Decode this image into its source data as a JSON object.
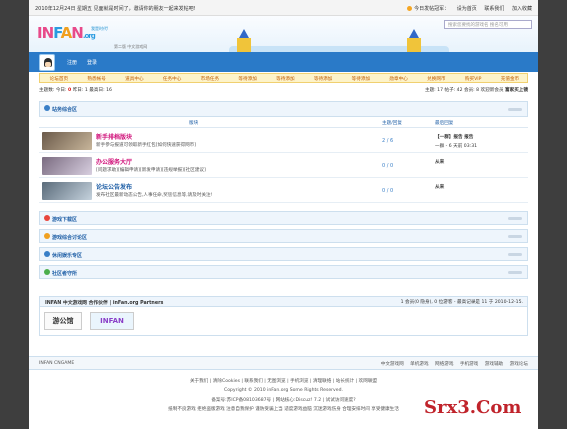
{
  "topbar": {
    "left_text": "2010年12月24日 星期五 见面就是时间了，邀请你的朋友一起来发帖吧!",
    "right_links": [
      "今日发帖冠军：",
      "设为首页",
      "联系我们",
      "加入收藏"
    ]
  },
  "header": {
    "logo_parts": [
      "IN",
      "F",
      "A",
      "N",
      ".org"
    ],
    "logo_slogan": "我是时代!",
    "site_subtitle": "第二版 中文游戏网",
    "search_placeholder": "搜索您要找的游戏名  搜名可用"
  },
  "nav": {
    "register": "注册",
    "login": "登录"
  },
  "menu": [
    "论坛首页",
    "熟悉帐号",
    "道具中心",
    "任务中心",
    "市场任务",
    "等待添加",
    "等待添加",
    "等待添加",
    "等待添加",
    "勋章中心",
    "兑换网币",
    "购买VIP",
    "充值金币"
  ],
  "stats": {
    "left": "主题数:",
    "today_label": "今日:",
    "today_value": "0",
    "rest": "昨日: 1  最高日: 16",
    "right": "主题: 17  帖子: 42  会员: 8  欢迎新会员",
    "newest_member": "富家买上镜"
  },
  "section_main": {
    "title": "站务综合区",
    "col_forum": "版块",
    "col_posts": "主题/回复",
    "col_last": "最后回复"
  },
  "forums": [
    {
      "name": "新手排档版块",
      "desc": "新手参与报道可领取新手红包[如何快速获得网币]",
      "name_color": "#d0127a",
      "count": "2 / 6",
      "last_title": "【一群】报告  报告",
      "last_info": "一群 - 6 天前 03:31",
      "thumb_colors": [
        "#6b5a4a",
        "#c7b59a"
      ]
    },
    {
      "name": "办公服务大厅",
      "desc": "[问题求助][编辑申请][新发申请][违规举报][社区建议]",
      "name_color": "#d0127a",
      "count": "0 / 0",
      "last_title": "从来",
      "last_info": "",
      "thumb_colors": [
        "#7a6b80",
        "#d8cfe0"
      ]
    },
    {
      "name": "论坛公告发布",
      "desc": "发布社区最新动态公告,人事任命,奖惩信息等,请及时关注!",
      "name_color": "#1f5fa6",
      "count": "0 / 0",
      "last_title": "从来",
      "last_info": "",
      "thumb_colors": [
        "#5a6b7a",
        "#c5d2dd"
      ]
    }
  ],
  "sections": [
    {
      "title": "游戏下载区",
      "icon_color": "#e8453c"
    },
    {
      "title": "游戏综合讨论区",
      "icon_color": "#f0a020"
    },
    {
      "title": "休闲娱乐专区",
      "icon_color": "#3a7fc7"
    },
    {
      "title": "社区者守所",
      "icon_color": "#4cae4c"
    }
  ],
  "friends": {
    "title": "INFAN 中文游戏网  合作伙伴  |  inFan.org Partners",
    "stats": "1 会员(0 隐身), 0 位游客 - 最高记录是  11  于  2010-12-15.",
    "link1": "游公馆",
    "link2": "INFAN"
  },
  "footbar": {
    "left": "INFAN CNGAME",
    "right_links": [
      "中文游戏网",
      "单机游戏",
      "网络游戏",
      "手机游戏",
      "游戏辅助",
      "游戏论坛"
    ]
  },
  "copyright": [
    "关于我们 | 清除Cookies | 联系我们 | 无图浏览 | 手机浏览 | 清理联络 | 站长统计 | 欢网联盟",
    "Copyright © 2010 inFan.org Some Rights Reserved.",
    "备案号:苏ICP备08103687号 | 网站核心:Discuz! 7.2 | 试试访问速度?",
    "抵制不良游戏  拒绝盗版游戏  注意自我保护  谨防受骗上当  适度游戏益脑  沉迷游戏伤身  合理安排时间  享受健康生活"
  ],
  "watermark": "Srx3.Com"
}
